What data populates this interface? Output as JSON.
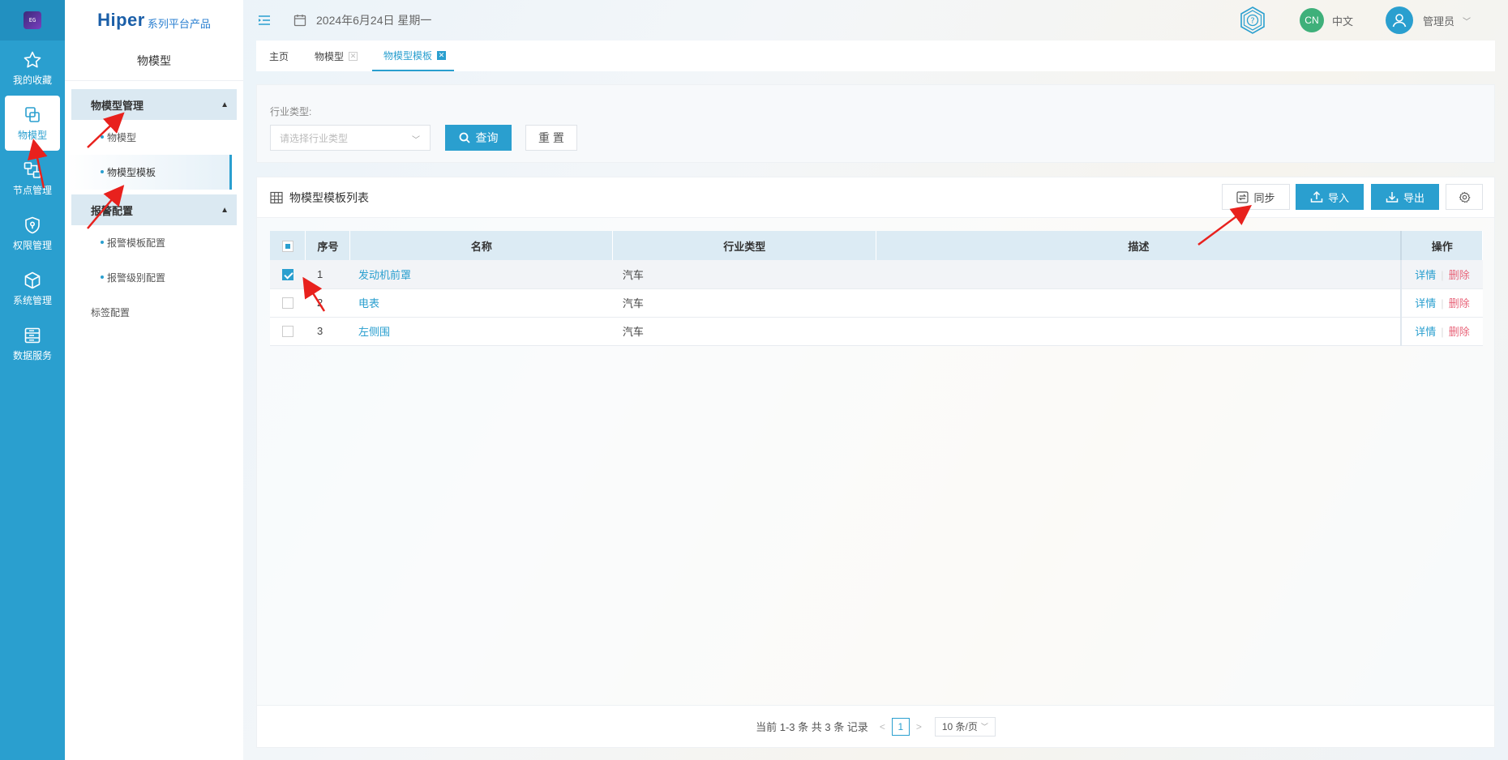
{
  "rail": {
    "items": [
      {
        "label": "我的收藏",
        "icon": "star-icon"
      },
      {
        "label": "物模型",
        "icon": "model-icon"
      },
      {
        "label": "节点管理",
        "icon": "node-icon"
      },
      {
        "label": "权限管理",
        "icon": "shield-icon"
      },
      {
        "label": "系统管理",
        "icon": "cube-icon"
      },
      {
        "label": "数据服务",
        "icon": "data-icon"
      }
    ],
    "logo_text": "EG"
  },
  "brand": {
    "name": "Hiper",
    "suffix": "系列平台产品"
  },
  "submenu": {
    "title": "物模型",
    "groups": [
      {
        "label": "物模型管理",
        "items": [
          "物模型",
          "物模型模板"
        ]
      },
      {
        "label": "报警配置",
        "items": [
          "报警模板配置",
          "报警级别配置"
        ]
      }
    ],
    "plain_item": "标签配置"
  },
  "topbar": {
    "date": "2024年6月24日 星期一",
    "lang_badge": "CN",
    "lang_label": "中文",
    "user": "管理员"
  },
  "tabs": [
    "主页",
    "物模型",
    "物模型模板"
  ],
  "filter": {
    "label": "行业类型:",
    "placeholder": "请选择行业类型",
    "query_button": "查询",
    "reset_button": "重 置"
  },
  "list": {
    "title": "物模型模板列表",
    "sync_button": "同步",
    "import_button": "导入",
    "export_button": "导出",
    "columns": [
      "序号",
      "名称",
      "行业类型",
      "描述",
      "操作"
    ],
    "rows": [
      {
        "index": "1",
        "name": "发动机前罩",
        "type": "汽车",
        "desc": "",
        "selected": true
      },
      {
        "index": "2",
        "name": "电表",
        "type": "汽车",
        "desc": "",
        "selected": false
      },
      {
        "index": "3",
        "name": "左侧围",
        "type": "汽车",
        "desc": "",
        "selected": false
      }
    ],
    "op_detail": "详情",
    "op_delete": "删除"
  },
  "pager": {
    "summary": "当前 1-3 条 共 3 条 记录",
    "page": "1",
    "page_size": "10 条/页"
  },
  "colors": {
    "accent": "#2a9fcf",
    "danger": "#e8657a",
    "annotation": "#e8211d"
  }
}
